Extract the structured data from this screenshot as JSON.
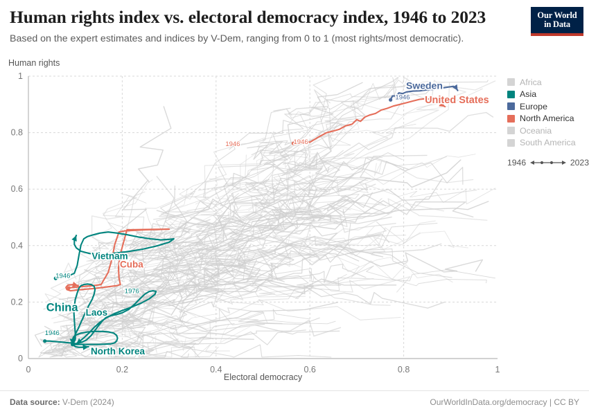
{
  "header": {
    "title": "Human rights index vs. electoral democracy index, 1946 to 2023",
    "subtitle": "Based on the expert estimates and indices by V-Dem, ranging from 0 to 1 (most rights/most democratic).",
    "logo_line1": "Our World",
    "logo_line2": "in Data",
    "logo_bg": "#002147",
    "logo_accent": "#c0392b"
  },
  "legend": {
    "items": [
      {
        "label": "Africa",
        "color": "#d4d4d4",
        "active": false
      },
      {
        "label": "Asia",
        "color": "#00847e",
        "active": true
      },
      {
        "label": "Europe",
        "color": "#4c6a9c",
        "active": true
      },
      {
        "label": "North America",
        "color": "#e56e5a",
        "active": true
      },
      {
        "label": "Oceania",
        "color": "#d4d4d4",
        "active": false
      },
      {
        "label": "South America",
        "color": "#d4d4d4",
        "active": false
      }
    ],
    "time_start": "1946",
    "time_end": "2023"
  },
  "footer": {
    "source_prefix": "Data source:",
    "source_value": "V-Dem (2024)",
    "license": "OurWorldInData.org/democracy | CC BY"
  },
  "chart_data": {
    "type": "line",
    "title": "Human rights index vs. electoral democracy index, 1946 to 2023",
    "subtitle": "Based on the expert estimates and indices by V-Dem, ranging from 0 to 1 (most rights/most democratic).",
    "xlabel": "Electoral democracy",
    "ylabel": "Human rights",
    "xlim": [
      0,
      1
    ],
    "ylim": [
      0,
      1
    ],
    "xticks": [
      "0",
      "0.2",
      "0.4",
      "0.6",
      "0.8",
      "1"
    ],
    "yticks": [
      "0",
      "0.2",
      "0.4",
      "0.6",
      "0.8",
      "1"
    ],
    "xtick_values": [
      0,
      0.2,
      0.4,
      0.6,
      0.8,
      1
    ],
    "ytick_values": [
      0,
      0.2,
      0.4,
      0.6,
      0.8,
      1
    ],
    "grid": true,
    "grid_style": "dashed",
    "legend_position": "right",
    "time_range": [
      1946,
      2023
    ],
    "background_series_note": "Many faint grey connected-scatter trajectories for all other countries",
    "annotations": [
      {
        "text": "Sweden",
        "x": 0.805,
        "y": 0.955,
        "color": "#4c6a9c",
        "font_size": 14
      },
      {
        "text": "United States",
        "x": 0.845,
        "y": 0.905,
        "color": "#e56e5a",
        "font_size": 14.5
      },
      {
        "text": "Vietnam",
        "x": 0.135,
        "y": 0.352,
        "color": "#00847e",
        "font_size": 13.5
      },
      {
        "text": "Cuba",
        "x": 0.195,
        "y": 0.322,
        "color": "#e56e5a",
        "font_size": 13.5
      },
      {
        "text": "China",
        "x": 0.038,
        "y": 0.168,
        "color": "#00847e",
        "font_size": 16.5
      },
      {
        "text": "Laos",
        "x": 0.122,
        "y": 0.152,
        "color": "#00847e",
        "font_size": 13.5
      },
      {
        "text": "North Korea",
        "x": 0.133,
        "y": 0.015,
        "color": "#00847e",
        "font_size": 13.5
      },
      {
        "text": "1946",
        "x": 0.782,
        "y": 0.918,
        "color": "#4c6a9c",
        "font_size": 9.5
      },
      {
        "text": "1946",
        "x": 0.42,
        "y": 0.752,
        "color": "#e56e5a",
        "font_size": 9.5
      },
      {
        "text": "1946",
        "x": 0.565,
        "y": 0.76,
        "color": "#e56e5a",
        "font_size": 9.5
      },
      {
        "text": "1946",
        "x": 0.058,
        "y": 0.285,
        "color": "#00847e",
        "font_size": 9.5
      },
      {
        "text": "1976",
        "x": 0.205,
        "y": 0.232,
        "color": "#00847e",
        "font_size": 9.5
      },
      {
        "text": "1946",
        "x": 0.035,
        "y": 0.083,
        "color": "#00847e",
        "font_size": 9.5
      }
    ],
    "series": [
      {
        "name": "Sweden",
        "continent": "Europe",
        "color": "#4c6a9c",
        "points": [
          [
            0.772,
            0.916
          ],
          [
            0.776,
            0.93
          ],
          [
            0.784,
            0.93
          ],
          [
            0.79,
            0.941
          ],
          [
            0.797,
            0.938
          ],
          [
            0.806,
            0.944
          ],
          [
            0.82,
            0.947
          ],
          [
            0.835,
            0.948
          ],
          [
            0.848,
            0.951
          ],
          [
            0.862,
            0.953
          ],
          [
            0.874,
            0.956
          ],
          [
            0.886,
            0.959
          ],
          [
            0.898,
            0.962
          ],
          [
            0.906,
            0.964
          ],
          [
            0.912,
            0.957
          ],
          [
            0.915,
            0.949
          ]
        ]
      },
      {
        "name": "United States",
        "continent": "North America",
        "color": "#e56e5a",
        "points": [
          [
            0.565,
            0.762
          ],
          [
            0.582,
            0.772
          ],
          [
            0.6,
            0.766
          ],
          [
            0.618,
            0.784
          ],
          [
            0.636,
            0.8
          ],
          [
            0.65,
            0.806
          ],
          [
            0.663,
            0.812
          ],
          [
            0.676,
            0.824
          ],
          [
            0.69,
            0.83
          ],
          [
            0.7,
            0.846
          ],
          [
            0.708,
            0.84
          ],
          [
            0.717,
            0.855
          ],
          [
            0.727,
            0.862
          ],
          [
            0.74,
            0.868
          ],
          [
            0.752,
            0.88
          ],
          [
            0.765,
            0.886
          ],
          [
            0.778,
            0.894
          ],
          [
            0.792,
            0.9
          ],
          [
            0.806,
            0.906
          ],
          [
            0.82,
            0.912
          ],
          [
            0.834,
            0.918
          ],
          [
            0.848,
            0.92
          ],
          [
            0.86,
            0.918
          ],
          [
            0.872,
            0.91
          ],
          [
            0.88,
            0.9
          ],
          [
            0.888,
            0.892
          ]
        ]
      },
      {
        "name": "Cuba",
        "continent": "North America",
        "color": "#e56e5a",
        "points": [
          [
            0.086,
            0.25
          ],
          [
            0.096,
            0.252
          ],
          [
            0.108,
            0.254
          ],
          [
            0.122,
            0.256
          ],
          [
            0.138,
            0.258
          ],
          [
            0.155,
            0.262
          ],
          [
            0.17,
            0.305
          ],
          [
            0.178,
            0.352
          ],
          [
            0.184,
            0.404
          ],
          [
            0.193,
            0.448
          ],
          [
            0.205,
            0.452
          ],
          [
            0.225,
            0.454
          ],
          [
            0.25,
            0.456
          ],
          [
            0.278,
            0.457
          ],
          [
            0.3,
            0.458
          ],
          [
            0.3,
            0.458
          ],
          [
            0.248,
            0.457
          ],
          [
            0.21,
            0.456
          ],
          [
            0.196,
            0.37
          ],
          [
            0.192,
            0.322
          ],
          [
            0.193,
            0.285
          ],
          [
            0.196,
            0.262
          ],
          [
            0.188,
            0.258
          ],
          [
            0.168,
            0.254
          ],
          [
            0.14,
            0.248
          ],
          [
            0.112,
            0.244
          ],
          [
            0.09,
            0.24
          ],
          [
            0.082,
            0.244
          ],
          [
            0.08,
            0.252
          ],
          [
            0.084,
            0.26
          ],
          [
            0.096,
            0.262
          ],
          [
            0.106,
            0.258
          ]
        ]
      },
      {
        "name": "Vietnam",
        "continent": "Asia",
        "color": "#00847e",
        "points": [
          [
            0.058,
            0.284
          ],
          [
            0.066,
            0.286
          ],
          [
            0.074,
            0.288
          ],
          [
            0.082,
            0.292
          ],
          [
            0.09,
            0.296
          ],
          [
            0.098,
            0.302
          ],
          [
            0.104,
            0.33
          ],
          [
            0.108,
            0.368
          ],
          [
            0.112,
            0.402
          ],
          [
            0.118,
            0.424
          ],
          [
            0.126,
            0.432
          ],
          [
            0.138,
            0.438
          ],
          [
            0.152,
            0.444
          ],
          [
            0.17,
            0.448
          ],
          [
            0.19,
            0.444
          ],
          [
            0.212,
            0.438
          ],
          [
            0.236,
            0.43
          ],
          [
            0.26,
            0.424
          ],
          [
            0.282,
            0.42
          ],
          [
            0.3,
            0.422
          ],
          [
            0.31,
            0.424
          ],
          [
            0.3,
            0.412
          ],
          [
            0.272,
            0.398
          ],
          [
            0.24,
            0.386
          ],
          [
            0.208,
            0.378
          ],
          [
            0.178,
            0.372
          ],
          [
            0.152,
            0.37
          ],
          [
            0.13,
            0.372
          ],
          [
            0.112,
            0.38
          ],
          [
            0.102,
            0.392
          ],
          [
            0.098,
            0.404
          ],
          [
            0.098,
            0.42
          ],
          [
            0.102,
            0.436
          ]
        ]
      },
      {
        "name": "China",
        "continent": "Asia",
        "color": "#00847e",
        "points": [
          [
            0.035,
            0.062
          ],
          [
            0.045,
            0.062
          ],
          [
            0.058,
            0.06
          ],
          [
            0.072,
            0.058
          ],
          [
            0.086,
            0.056
          ],
          [
            0.096,
            0.055
          ],
          [
            0.1,
            0.068
          ],
          [
            0.1,
            0.088
          ],
          [
            0.099,
            0.11
          ],
          [
            0.098,
            0.135
          ],
          [
            0.097,
            0.16
          ],
          [
            0.098,
            0.186
          ],
          [
            0.1,
            0.21
          ],
          [
            0.104,
            0.232
          ],
          [
            0.108,
            0.25
          ],
          [
            0.112,
            0.258
          ],
          [
            0.118,
            0.262
          ],
          [
            0.126,
            0.264
          ],
          [
            0.134,
            0.262
          ],
          [
            0.14,
            0.256
          ],
          [
            0.142,
            0.244
          ],
          [
            0.14,
            0.228
          ],
          [
            0.136,
            0.21
          ],
          [
            0.13,
            0.192
          ],
          [
            0.124,
            0.172
          ],
          [
            0.118,
            0.15
          ],
          [
            0.112,
            0.128
          ],
          [
            0.106,
            0.106
          ],
          [
            0.1,
            0.086
          ],
          [
            0.096,
            0.068
          ],
          [
            0.094,
            0.056
          ],
          [
            0.094,
            0.05
          ]
        ]
      },
      {
        "name": "Laos",
        "continent": "Asia",
        "color": "#00847e",
        "points": [
          [
            0.096,
            0.052
          ],
          [
            0.104,
            0.054
          ],
          [
            0.114,
            0.058
          ],
          [
            0.124,
            0.066
          ],
          [
            0.134,
            0.082
          ],
          [
            0.142,
            0.1
          ],
          [
            0.15,
            0.118
          ],
          [
            0.158,
            0.134
          ],
          [
            0.166,
            0.146
          ],
          [
            0.176,
            0.152
          ],
          [
            0.188,
            0.156
          ],
          [
            0.2,
            0.162
          ],
          [
            0.214,
            0.174
          ],
          [
            0.226,
            0.192
          ],
          [
            0.238,
            0.212
          ],
          [
            0.248,
            0.228
          ],
          [
            0.258,
            0.238
          ],
          [
            0.266,
            0.24
          ],
          [
            0.272,
            0.238
          ],
          [
            0.27,
            0.228
          ],
          [
            0.258,
            0.212
          ],
          [
            0.24,
            0.196
          ],
          [
            0.22,
            0.182
          ],
          [
            0.2,
            0.17
          ],
          [
            0.182,
            0.158
          ],
          [
            0.166,
            0.144
          ],
          [
            0.152,
            0.128
          ],
          [
            0.14,
            0.11
          ],
          [
            0.13,
            0.092
          ],
          [
            0.12,
            0.076
          ],
          [
            0.11,
            0.062
          ],
          [
            0.102,
            0.052
          ]
        ]
      },
      {
        "name": "North Korea",
        "continent": "Asia",
        "color": "#00847e",
        "points": [
          [
            0.094,
            0.05
          ],
          [
            0.104,
            0.05
          ],
          [
            0.118,
            0.05
          ],
          [
            0.134,
            0.05
          ],
          [
            0.15,
            0.05
          ],
          [
            0.164,
            0.051
          ],
          [
            0.176,
            0.052
          ],
          [
            0.184,
            0.056
          ],
          [
            0.188,
            0.062
          ],
          [
            0.19,
            0.072
          ],
          [
            0.188,
            0.082
          ],
          [
            0.182,
            0.09
          ],
          [
            0.172,
            0.094
          ],
          [
            0.158,
            0.096
          ],
          [
            0.142,
            0.096
          ],
          [
            0.126,
            0.094
          ],
          [
            0.112,
            0.09
          ],
          [
            0.102,
            0.084
          ],
          [
            0.096,
            0.076
          ],
          [
            0.094,
            0.066
          ],
          [
            0.094,
            0.056
          ],
          [
            0.096,
            0.048
          ],
          [
            0.1,
            0.042
          ],
          [
            0.108,
            0.04
          ],
          [
            0.118,
            0.04
          ],
          [
            0.128,
            0.042
          ]
        ]
      }
    ]
  }
}
